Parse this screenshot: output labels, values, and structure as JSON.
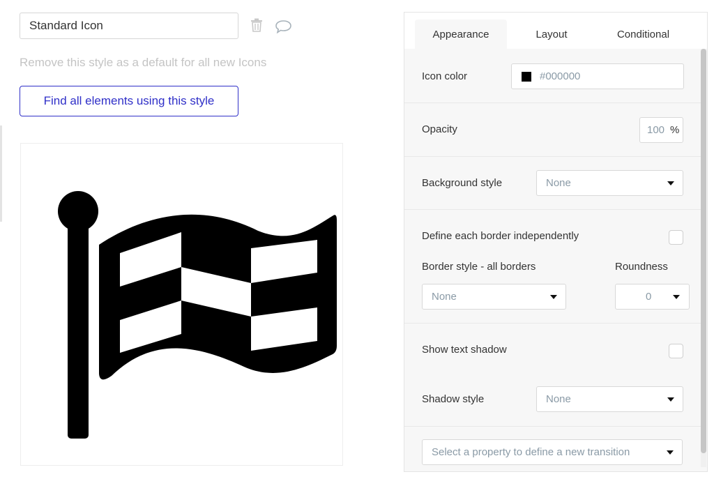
{
  "style_name": "Standard Icon",
  "remove_default_text": "Remove this style as a default for all new Icons",
  "find_button_label": "Find all elements using this style",
  "tabs": [
    {
      "label": "Appearance",
      "active": true
    },
    {
      "label": "Layout",
      "active": false
    },
    {
      "label": "Conditional",
      "active": false
    }
  ],
  "appearance": {
    "icon_color_label": "Icon color",
    "icon_color_value": "#000000",
    "opacity_label": "Opacity",
    "opacity_value": "100",
    "opacity_unit": "%",
    "background_style_label": "Background style",
    "background_style_value": "None",
    "define_border_label": "Define each border independently",
    "border_style_label": "Border style - all borders",
    "border_style_value": "None",
    "roundness_label": "Roundness",
    "roundness_value": "0",
    "show_text_shadow_label": "Show text shadow",
    "shadow_style_label": "Shadow style",
    "shadow_style_value": "None",
    "transition_placeholder": "Select a property to define a new transition"
  },
  "icons": {
    "delete": "trash-icon",
    "comment": "comment-icon",
    "preview": "checkered-flag-icon",
    "dropdown": "caret-down-icon"
  },
  "colors": {
    "accent": "#2f2fc8",
    "icon_color": "#000000",
    "muted_text": "#c4c4c4",
    "value_text": "#8a9aa6"
  }
}
